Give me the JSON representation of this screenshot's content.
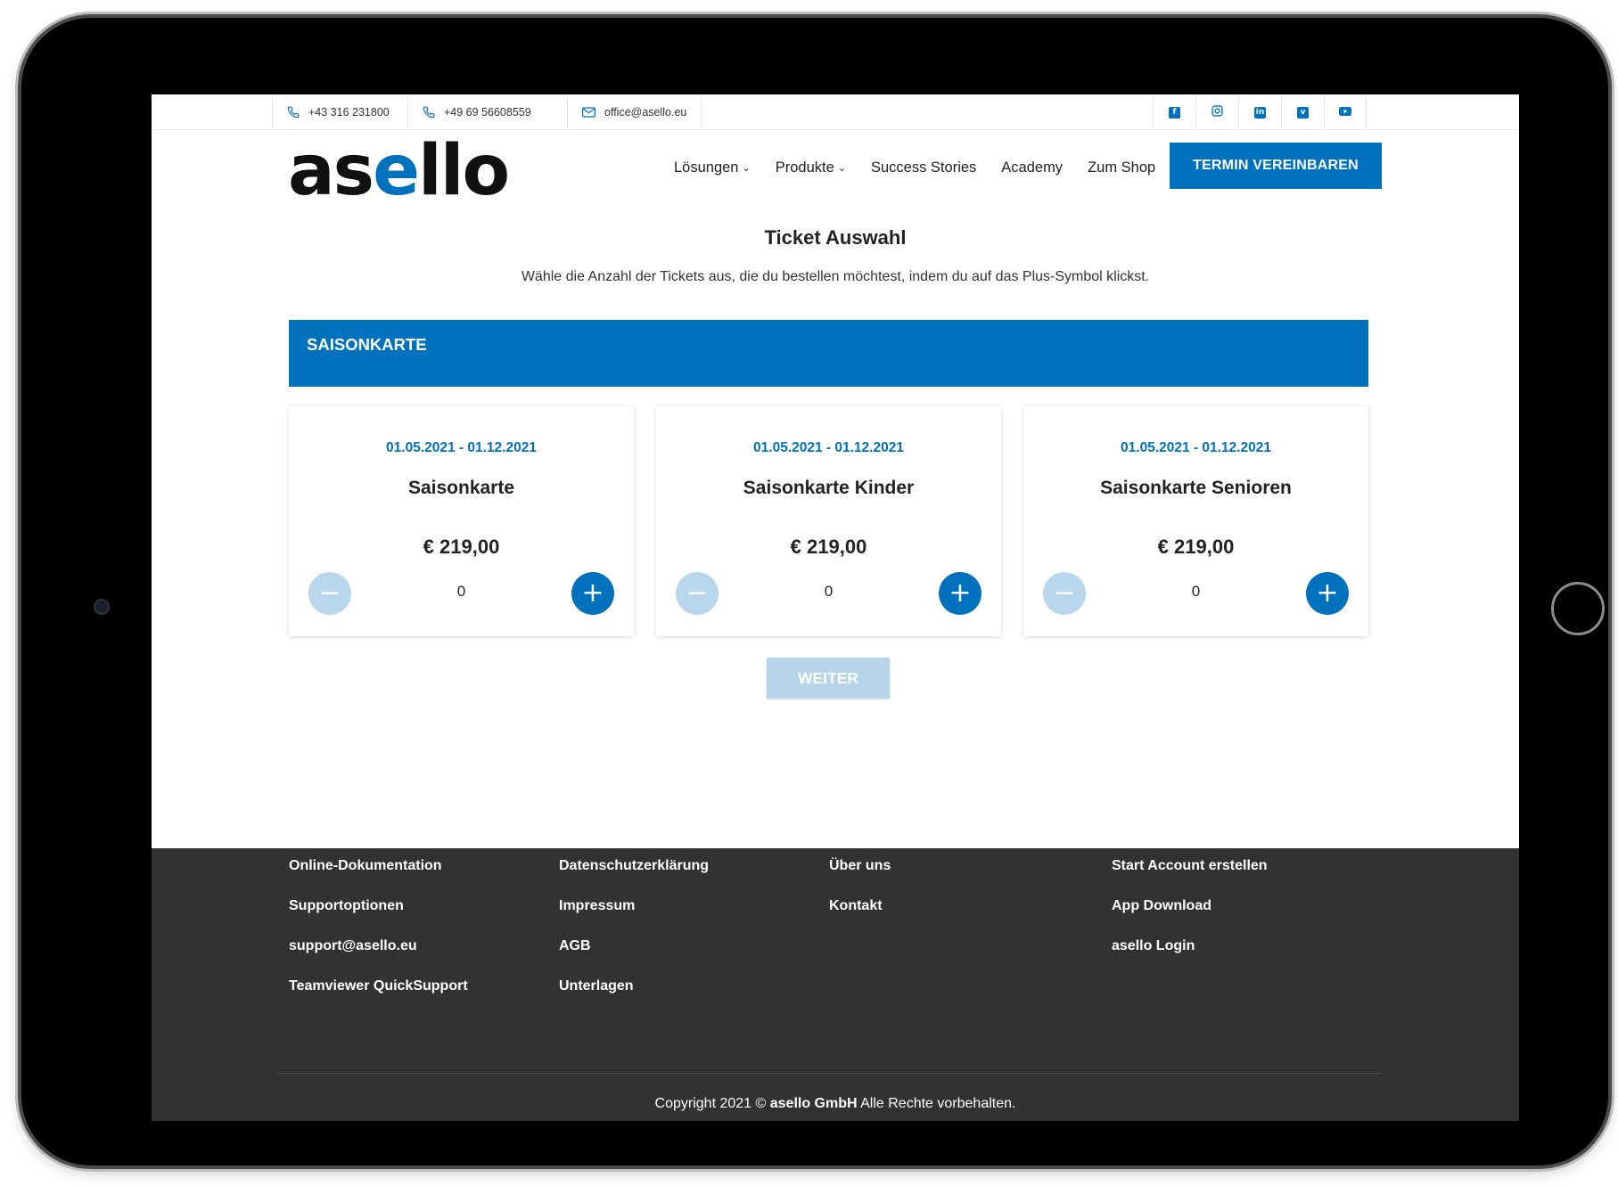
{
  "topbar": {
    "phone1": "+43 316 231800",
    "phone2": "+49 69 56608559",
    "email": "office@asello.eu",
    "social": [
      "facebook-icon",
      "instagram-icon",
      "linkedin-icon",
      "vimeo-icon",
      "youtube-icon"
    ]
  },
  "header": {
    "logo_part1": "as",
    "logo_part2": "e",
    "logo_part3": "llo",
    "nav": {
      "loesungen": "Lösungen",
      "produkte": "Produkte",
      "success": "Success Stories",
      "academy": "Academy",
      "shop": "Zum Shop"
    },
    "cta": "TERMIN VEREINBAREN"
  },
  "main": {
    "title": "Ticket Auswahl",
    "subtitle": "Wähle die Anzahl der Tickets aus, die du bestellen möchtest, indem du auf das Plus-Symbol klickst.",
    "banner": "SAISONKARTE",
    "tickets": [
      {
        "date": "01.05.2021 - 01.12.2021",
        "name": "Saisonkarte",
        "price": "€ 219,00",
        "qty": "0"
      },
      {
        "date": "01.05.2021 - 01.12.2021",
        "name": "Saisonkarte Kinder",
        "price": "€ 219,00",
        "qty": "0"
      },
      {
        "date": "01.05.2021 - 01.12.2021",
        "name": "Saisonkarte Senioren",
        "price": "€ 219,00",
        "qty": "0"
      }
    ],
    "next_button": "WEITER"
  },
  "footer": {
    "col1": [
      "Online-Dokumentation",
      "Supportoptionen",
      "support@asello.eu",
      "Teamviewer QuickSupport"
    ],
    "col2": [
      "Datenschutzerklärung",
      "Impressum",
      "AGB",
      "Unterlagen"
    ],
    "col3": [
      "Über uns",
      "Kontakt"
    ],
    "col4": [
      "Start Account erstellen",
      "App Download",
      "asello Login"
    ],
    "copyright_prefix": "Copyright 2021 ©",
    "copyright_company": "asello GmbH",
    "copyright_suffix": "Alle Rechte vorbehalten."
  },
  "colors": {
    "accent": "#0071bc",
    "accent_light": "#b8d6ec",
    "footer_bg": "#323232"
  }
}
